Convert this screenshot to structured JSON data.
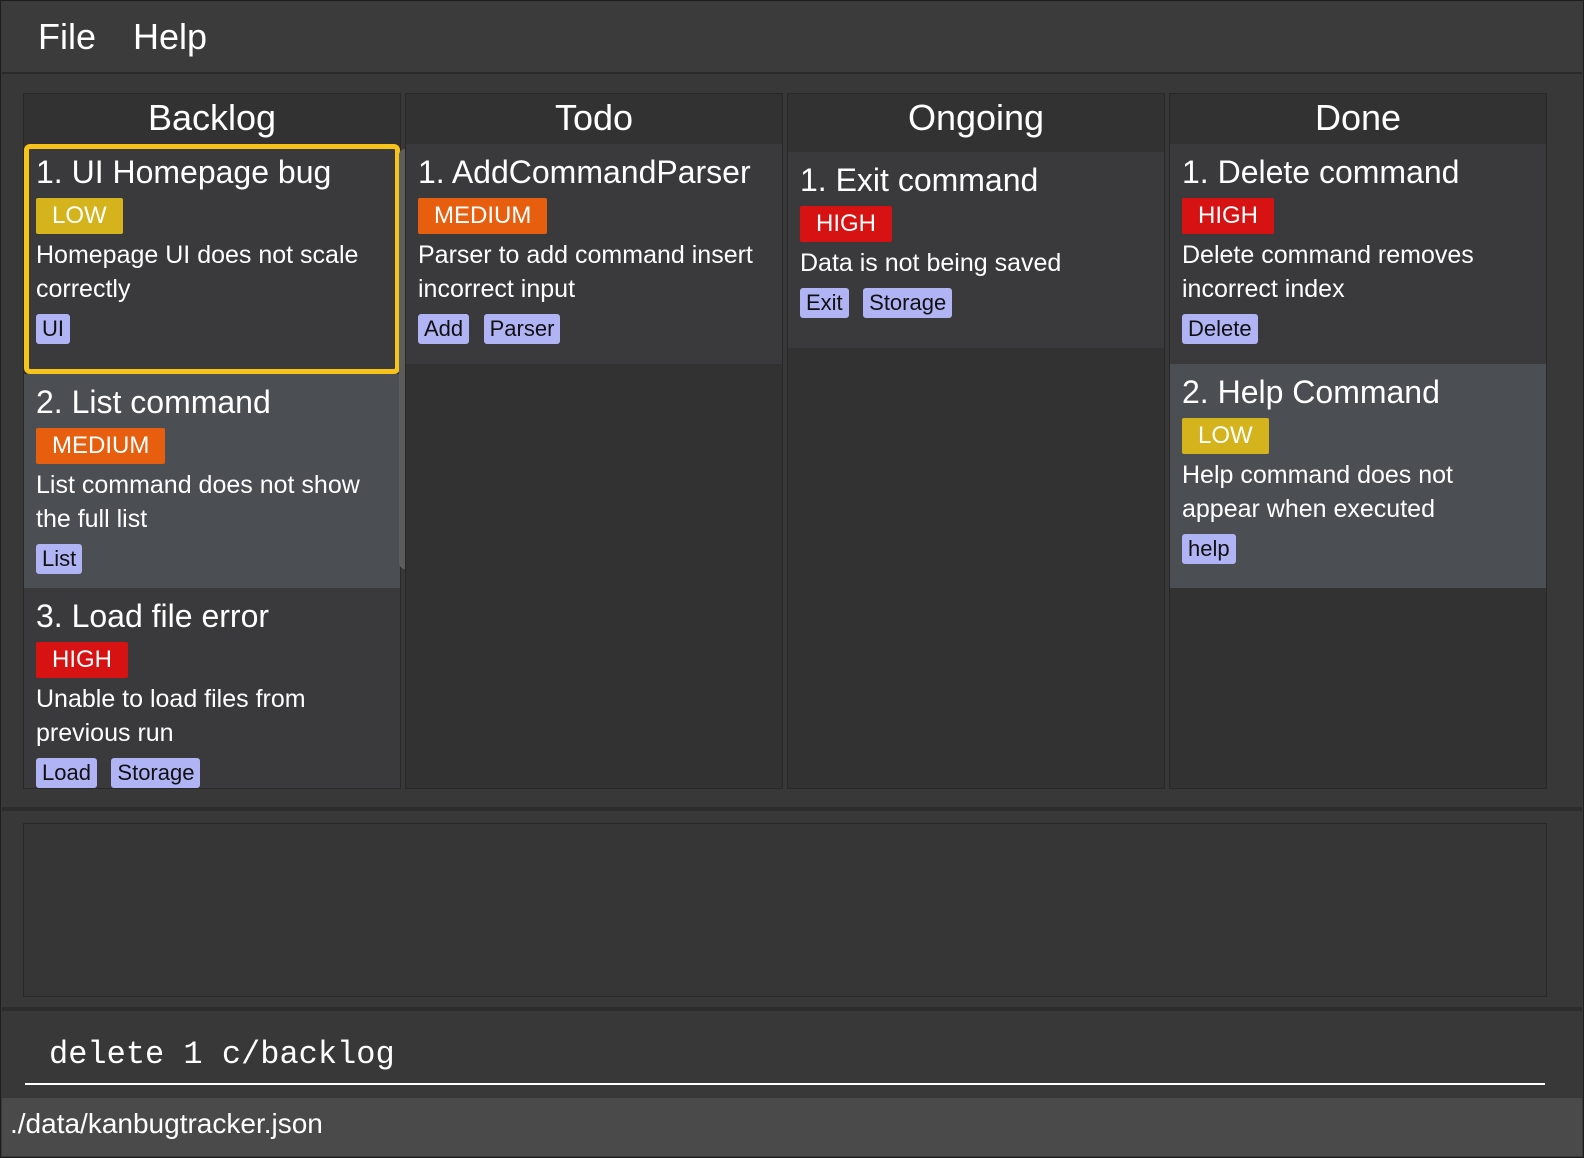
{
  "menu": {
    "file": "File",
    "help": "Help"
  },
  "columns": [
    {
      "title": "Backlog",
      "cards": [
        {
          "title": "1. UI Homepage bug",
          "priority": "LOW",
          "description": "Homepage UI does not scale correctly",
          "tags": [
            "UI"
          ],
          "selected": true
        },
        {
          "title": "2. List command",
          "priority": "MEDIUM",
          "description": "List command does not show the full list",
          "tags": [
            "List"
          ]
        },
        {
          "title": "3. Load file error",
          "priority": "HIGH",
          "description": "Unable to load files from previous run",
          "tags": [
            "Load",
            "Storage"
          ]
        }
      ]
    },
    {
      "title": "Todo",
      "cards": [
        {
          "title": "1. AddCommandParser",
          "priority": "MEDIUM",
          "description": "Parser to add command insert incorrect input",
          "tags": [
            "Add",
            "Parser"
          ]
        }
      ]
    },
    {
      "title": "Ongoing",
      "cards": [
        {
          "title": "1. Exit command",
          "priority": "HIGH",
          "description": "Data is not being saved",
          "tags": [
            "Exit",
            "Storage"
          ]
        }
      ]
    },
    {
      "title": "Done",
      "cards": [
        {
          "title": "1. Delete command",
          "priority": "HIGH",
          "description": "Delete command removes incorrect index",
          "tags": [
            "Delete"
          ]
        },
        {
          "title": "2. Help Command",
          "priority": "LOW",
          "description": "Help command does not appear when executed",
          "tags": [
            "help"
          ]
        }
      ]
    }
  ],
  "command": {
    "value": "delete 1 c/backlog"
  },
  "status": {
    "file_path": "./data/kanbugtracker.json"
  },
  "colors": {
    "low": "#d4b31c",
    "medium": "#e85e0f",
    "high": "#d71212",
    "tag": "#b0b3f4",
    "selection": "#f6c31a"
  }
}
